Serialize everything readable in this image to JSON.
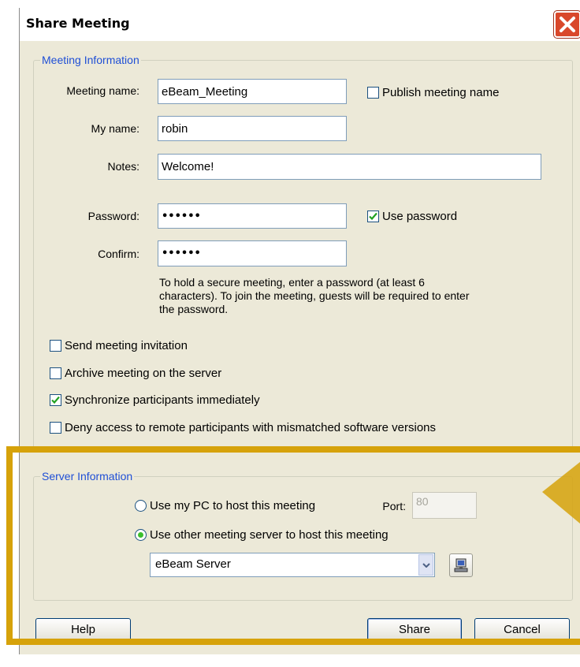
{
  "window": {
    "title": "Share Meeting"
  },
  "meeting_info": {
    "legend": "Meeting Information",
    "meeting_name": {
      "label": "Meeting name:",
      "value": "eBeam_Meeting"
    },
    "publish_name": {
      "label": "Publish meeting name",
      "checked": false
    },
    "my_name": {
      "label": "My name:",
      "value": "robin"
    },
    "notes": {
      "label": "Notes:",
      "value": "Welcome!"
    },
    "password": {
      "label": "Password:",
      "value": "••••••"
    },
    "use_password": {
      "label": "Use password",
      "checked": true
    },
    "confirm": {
      "label": "Confirm:",
      "value": "••••••"
    },
    "hint_line1": "To hold a secure meeting, enter a password (at least 6",
    "hint_line2": "characters). To join the meeting, guests will be required to enter",
    "hint_line3": "the password.",
    "send_invitation": {
      "label": "Send meeting invitation",
      "checked": false
    },
    "archive": {
      "label": "Archive meeting on the server",
      "checked": false
    },
    "synchronize": {
      "label": "Synchronize participants immediately",
      "checked": true
    },
    "deny_access": {
      "label": "Deny access to remote participants with mismatched software versions",
      "checked": false
    }
  },
  "server_info": {
    "legend": "Server Information",
    "use_my_pc": {
      "label": "Use my PC to host this meeting",
      "selected": false
    },
    "port": {
      "label": "Port:",
      "value": "80"
    },
    "use_other": {
      "label": "Use other meeting server to host this meeting",
      "selected": true
    },
    "server_select": {
      "value": "eBeam Server"
    }
  },
  "buttons": {
    "help": "Help",
    "share": "Share",
    "cancel": "Cancel"
  },
  "colors": {
    "highlight": "#d6a20a",
    "legend": "#1f4fd6",
    "close": "#d9482b"
  }
}
